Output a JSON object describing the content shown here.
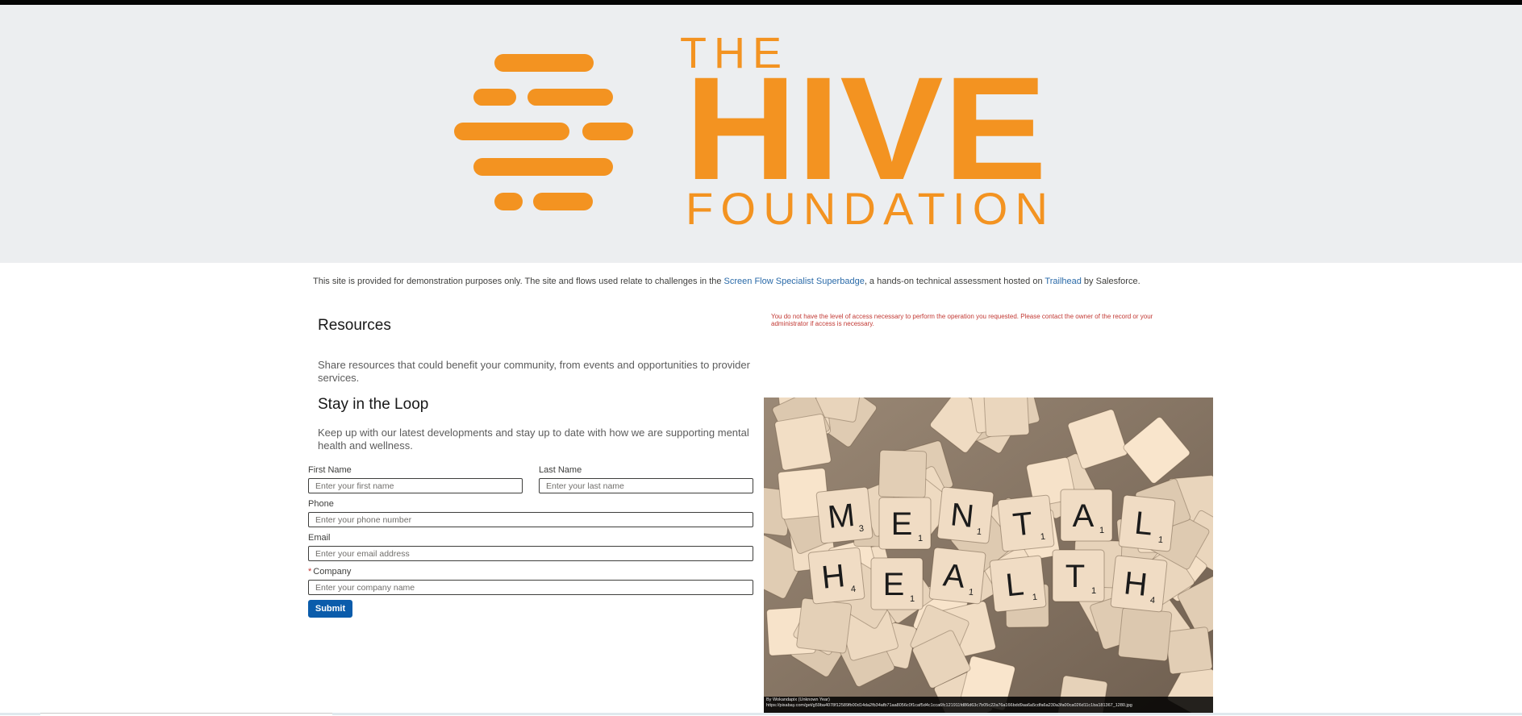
{
  "brand": {
    "line1": "THE",
    "line2": "HIVE",
    "line3": "FOUNDATION",
    "color": "#f39321"
  },
  "disclaimer": {
    "prefix": "This site is provided for demonstration purposes only. The site and flows used relate to challenges in the ",
    "link1": "Screen Flow Specialist Superbadge",
    "middle": ", a hands-on technical assessment hosted on ",
    "link2": "Trailhead",
    "suffix": " by Salesforce."
  },
  "resources": {
    "title": "Resources",
    "description": "Share resources that could benefit your community, from events and opportunities to provider services."
  },
  "loop": {
    "title": "Stay in the Loop",
    "description": "Keep up with our latest developments and stay up to date with how we are supporting mental health and wellness."
  },
  "form": {
    "first_name": {
      "label": "First Name",
      "placeholder": "Enter your first name",
      "value": ""
    },
    "last_name": {
      "label": "Last Name",
      "placeholder": "Enter your last name",
      "value": ""
    },
    "phone": {
      "label": "Phone",
      "placeholder": "Enter your phone number",
      "value": ""
    },
    "email": {
      "label": "Email",
      "placeholder": "Enter your email address",
      "value": ""
    },
    "company": {
      "label": "Company",
      "required_mark": "*",
      "placeholder": "Enter your company name",
      "value": ""
    },
    "submit_label": "Submit"
  },
  "error_message": "You do not have the level of access necessary to perform the operation you requested. Please contact the owner of the record or your administrator if access is necessary.",
  "image": {
    "row1_letters": [
      "M",
      "E",
      "N",
      "T",
      "A",
      "L"
    ],
    "row1_points": [
      "3",
      "1",
      "1",
      "1",
      "1",
      "1"
    ],
    "row2_letters": [
      "H",
      "E",
      "A",
      "L",
      "T",
      "H"
    ],
    "row2_points": [
      "4",
      "1",
      "1",
      "1",
      "1",
      "4"
    ],
    "caption_line1": "By Wokandapix (Unknown Year)",
    "caption_line2": "https://pixabay.com/get/g59ba4078f12589fb00d14da2fb34afb71aa8056c0f1caf5d4c1cca6fc121911fd86d63c7b05c22a76a166bdd9aa6a5cdfa6a230a3fa00ca026d11c1ba181367_1280.jpg"
  }
}
